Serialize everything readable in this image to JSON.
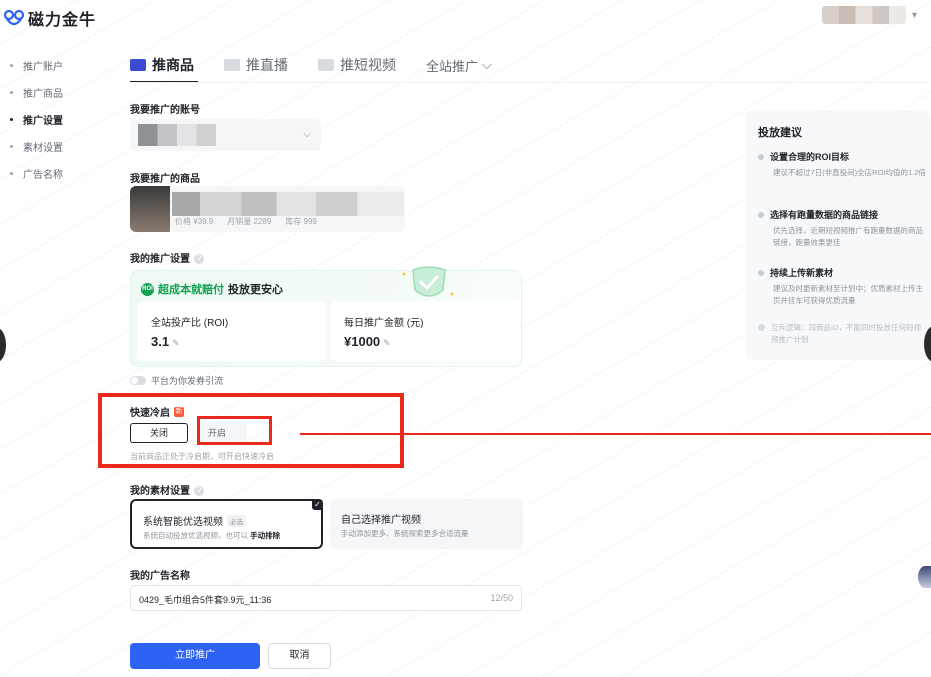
{
  "header": {
    "app_name": "磁力金牛",
    "user_menu_chevron": "▾"
  },
  "sidebar": {
    "items": [
      {
        "label": "推广账户",
        "active": false
      },
      {
        "label": "推广商品",
        "active": false
      },
      {
        "label": "推广设置",
        "active": true
      },
      {
        "label": "素材设置",
        "active": false
      },
      {
        "label": "广告名称",
        "active": false
      }
    ]
  },
  "tabs": {
    "items": [
      {
        "label": "推商品",
        "active": true
      },
      {
        "label": "推直播",
        "active": false
      },
      {
        "label": "推短视频",
        "active": false
      }
    ],
    "dropdown_label": "全站推广",
    "dropdown_chevron": "⌵"
  },
  "account_section": {
    "label": "我要推广的账号",
    "chevron": "⌵"
  },
  "product_section": {
    "label": "我要推广的商品",
    "meta": [
      "价格 ¥39.9",
      "月销量 2289",
      "库存 999"
    ]
  },
  "promo_settings": {
    "label": "我的推广设置",
    "info_icon": "?",
    "banner_badge": "ROI",
    "banner_green": "超成本就赔付",
    "banner_dark": "投放更安心",
    "roi_title": "全站投产比 (ROI)",
    "roi_value": "3.1",
    "budget_title": "每日推广金额 (元)",
    "budget_value": "¥1000",
    "edit_icon": "✎",
    "platform_toggle_label": "平台为你发券引流"
  },
  "cold_start": {
    "label": "快速冷启",
    "new_badge": "新",
    "off_label": "关闭",
    "on_label": "开启",
    "selected": "off",
    "hint": "当前商品正处于冷启期，可开启快速冷启"
  },
  "material": {
    "label": "我的素材设置",
    "options": [
      {
        "title": "系统智能优选视频",
        "tag": "必选",
        "desc_prefix": "系统自动投放优选视频，也可以",
        "desc_bold": "手动排除",
        "selected": true
      },
      {
        "title": "自己选择推广视频",
        "desc": "手动添加更多、系统探索更多合适流量",
        "selected": false
      }
    ],
    "check": "✓"
  },
  "ad_name": {
    "label": "我的广告名称",
    "value": "0429_毛巾组合5件套9.9元_11:36",
    "counter": "12/50"
  },
  "actions": {
    "submit": "立即推广",
    "cancel": "取消"
  },
  "advice": {
    "title": "投放建议",
    "items": [
      {
        "title": "设置合理的ROI目标",
        "desc": "建议不超过7日(非直投间)全店ROI均值的1.2倍"
      },
      {
        "title": "选择有跑量数据的商品链接",
        "desc": "优先选择，近期短视频推广有跑量数据的商品链接，跑量效果更佳"
      },
      {
        "title": "持续上传新素材",
        "desc": "建议及时更新素材至计划中；优质素材上传主页并挂车可获得优质流量"
      }
    ],
    "note": "互斥逻辑：同商品ID，不能同时投放任何短视频推广计划"
  },
  "colors": {
    "primary": "#2e62f5",
    "annotation_red": "#e8291c",
    "promo_green": "#12a150",
    "new_badge": "#ff5a36"
  }
}
